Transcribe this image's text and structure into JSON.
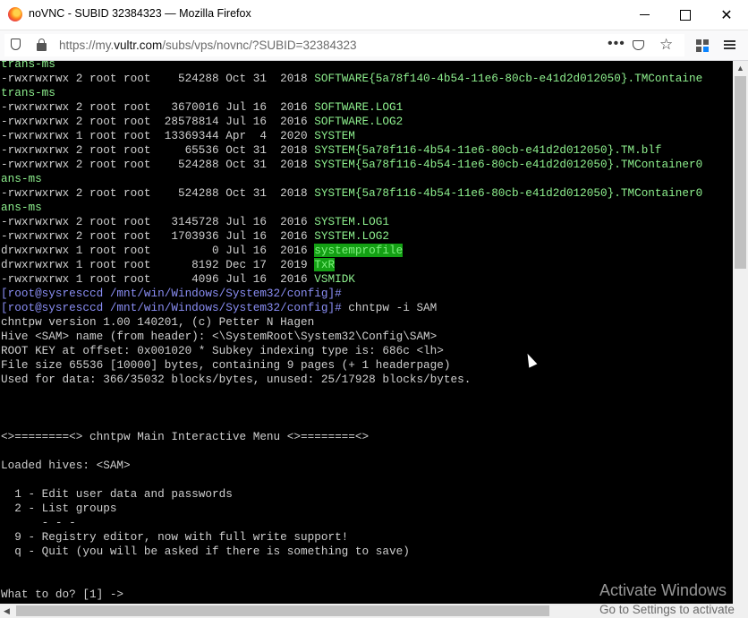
{
  "window": {
    "title": "noVNC - SUBID 32384323 — Mozilla Firefox",
    "controls": {
      "minimize": "minimize-icon",
      "maximize": "maximize-icon",
      "close": "✕"
    }
  },
  "navbar": {
    "url_prefix": "https://my.",
    "url_host": "vultr.com",
    "url_path": "/subs/vps/novnc/?SUBID=32384323",
    "page_actions": "•••",
    "bookmark": "☆",
    "icons": [
      "shield-icon",
      "lock-icon",
      "pocket-icon",
      "star-icon",
      "extensions-icon",
      "menu-icon"
    ]
  },
  "terminal": {
    "lines": [
      {
        "segs": [
          {
            "t": "trans-ms",
            "c": "g"
          }
        ]
      },
      {
        "segs": [
          {
            "t": "-rwxrwxrwx 2 root root    524288 Oct 31  2018 "
          },
          {
            "t": "SOFTWARE{5a78f140-4b54-11e6-80cb-e41d2d012050}.TMContaine",
            "c": "g"
          }
        ]
      },
      {
        "segs": [
          {
            "t": "trans-ms",
            "c": "g"
          }
        ]
      },
      {
        "segs": [
          {
            "t": "-rwxrwxrwx 2 root root   3670016 Jul 16  2016 "
          },
          {
            "t": "SOFTWARE.LOG1",
            "c": "g"
          }
        ]
      },
      {
        "segs": [
          {
            "t": "-rwxrwxrwx 2 root root  28578814 Jul 16  2016 "
          },
          {
            "t": "SOFTWARE.LOG2",
            "c": "g"
          }
        ]
      },
      {
        "segs": [
          {
            "t": "-rwxrwxrwx 1 root root  13369344 Apr  4  2020 "
          },
          {
            "t": "SYSTEM",
            "c": "g"
          }
        ]
      },
      {
        "segs": [
          {
            "t": "-rwxrwxrwx 2 root root     65536 Oct 31  2018 "
          },
          {
            "t": "SYSTEM{5a78f116-4b54-11e6-80cb-e41d2d012050}.TM.blf",
            "c": "g"
          }
        ]
      },
      {
        "segs": [
          {
            "t": "-rwxrwxrwx 2 root root    524288 Oct 31  2018 "
          },
          {
            "t": "SYSTEM{5a78f116-4b54-11e6-80cb-e41d2d012050}.TMContainer0",
            "c": "g"
          }
        ]
      },
      {
        "segs": [
          {
            "t": "ans-ms",
            "c": "g"
          }
        ]
      },
      {
        "segs": [
          {
            "t": "-rwxrwxrwx 2 root root    524288 Oct 31  2018 "
          },
          {
            "t": "SYSTEM{5a78f116-4b54-11e6-80cb-e41d2d012050}.TMContainer0",
            "c": "g"
          }
        ]
      },
      {
        "segs": [
          {
            "t": "ans-ms",
            "c": "g"
          }
        ]
      },
      {
        "segs": [
          {
            "t": "-rwxrwxrwx 2 root root   3145728 Jul 16  2016 "
          },
          {
            "t": "SYSTEM.LOG1",
            "c": "g"
          }
        ]
      },
      {
        "segs": [
          {
            "t": "-rwxrwxrwx 2 root root   1703936 Jul 16  2016 "
          },
          {
            "t": "SYSTEM.LOG2",
            "c": "g"
          }
        ]
      },
      {
        "segs": [
          {
            "t": "drwxrwxrwx 1 root root         0 Jul 16  2016 "
          },
          {
            "t": "systemprofile",
            "c": "hl"
          }
        ]
      },
      {
        "segs": [
          {
            "t": "drwxrwxrwx 1 root root      8192 Dec 17  2019 "
          },
          {
            "t": "TxR",
            "c": "hl"
          }
        ]
      },
      {
        "segs": [
          {
            "t": "-rwxrwxrwx 1 root root      4096 Jul 16  2016 "
          },
          {
            "t": "VSMIDK",
            "c": "g"
          }
        ]
      },
      {
        "segs": [
          {
            "t": "[root@sysresccd /mnt/win/Windows/System32/config]#",
            "c": "b"
          }
        ]
      },
      {
        "segs": [
          {
            "t": "[root@sysresccd /mnt/win/Windows/System32/config]#",
            "c": "b"
          },
          {
            "t": " chntpw -i SAM"
          }
        ]
      },
      {
        "segs": [
          {
            "t": "chntpw version 1.00 140201, (c) Petter N Hagen"
          }
        ]
      },
      {
        "segs": [
          {
            "t": "Hive <SAM> name (from header): <\\SystemRoot\\System32\\Config\\SAM>"
          }
        ]
      },
      {
        "segs": [
          {
            "t": "ROOT KEY at offset: 0x001020 * Subkey indexing type is: 686c <lh>"
          }
        ]
      },
      {
        "segs": [
          {
            "t": "File size 65536 [10000] bytes, containing 9 pages (+ 1 headerpage)"
          }
        ]
      },
      {
        "segs": [
          {
            "t": "Used for data: 366/35032 blocks/bytes, unused: 25/17928 blocks/bytes."
          }
        ]
      },
      {
        "segs": []
      },
      {
        "segs": []
      },
      {
        "segs": []
      },
      {
        "segs": [
          {
            "t": "<>========<> chntpw Main Interactive Menu <>========<>"
          }
        ]
      },
      {
        "segs": []
      },
      {
        "segs": [
          {
            "t": "Loaded hives: <SAM>"
          }
        ]
      },
      {
        "segs": []
      },
      {
        "segs": [
          {
            "t": "  1 - Edit user data and passwords"
          }
        ]
      },
      {
        "segs": [
          {
            "t": "  2 - List groups"
          }
        ]
      },
      {
        "segs": [
          {
            "t": "      - - -"
          }
        ]
      },
      {
        "segs": [
          {
            "t": "  9 - Registry editor, now with full write support!"
          }
        ]
      },
      {
        "segs": [
          {
            "t": "  q - Quit (you will be asked if there is something to save)"
          }
        ]
      },
      {
        "segs": []
      },
      {
        "segs": []
      },
      {
        "segs": [
          {
            "t": "What to do? [1] ->"
          }
        ]
      }
    ]
  },
  "watermark": {
    "title": "Activate Windows",
    "subtitle": "Go to Settings to activate"
  },
  "scrollbars": {
    "up_arrow": "▲",
    "left_arrow": "◀"
  }
}
